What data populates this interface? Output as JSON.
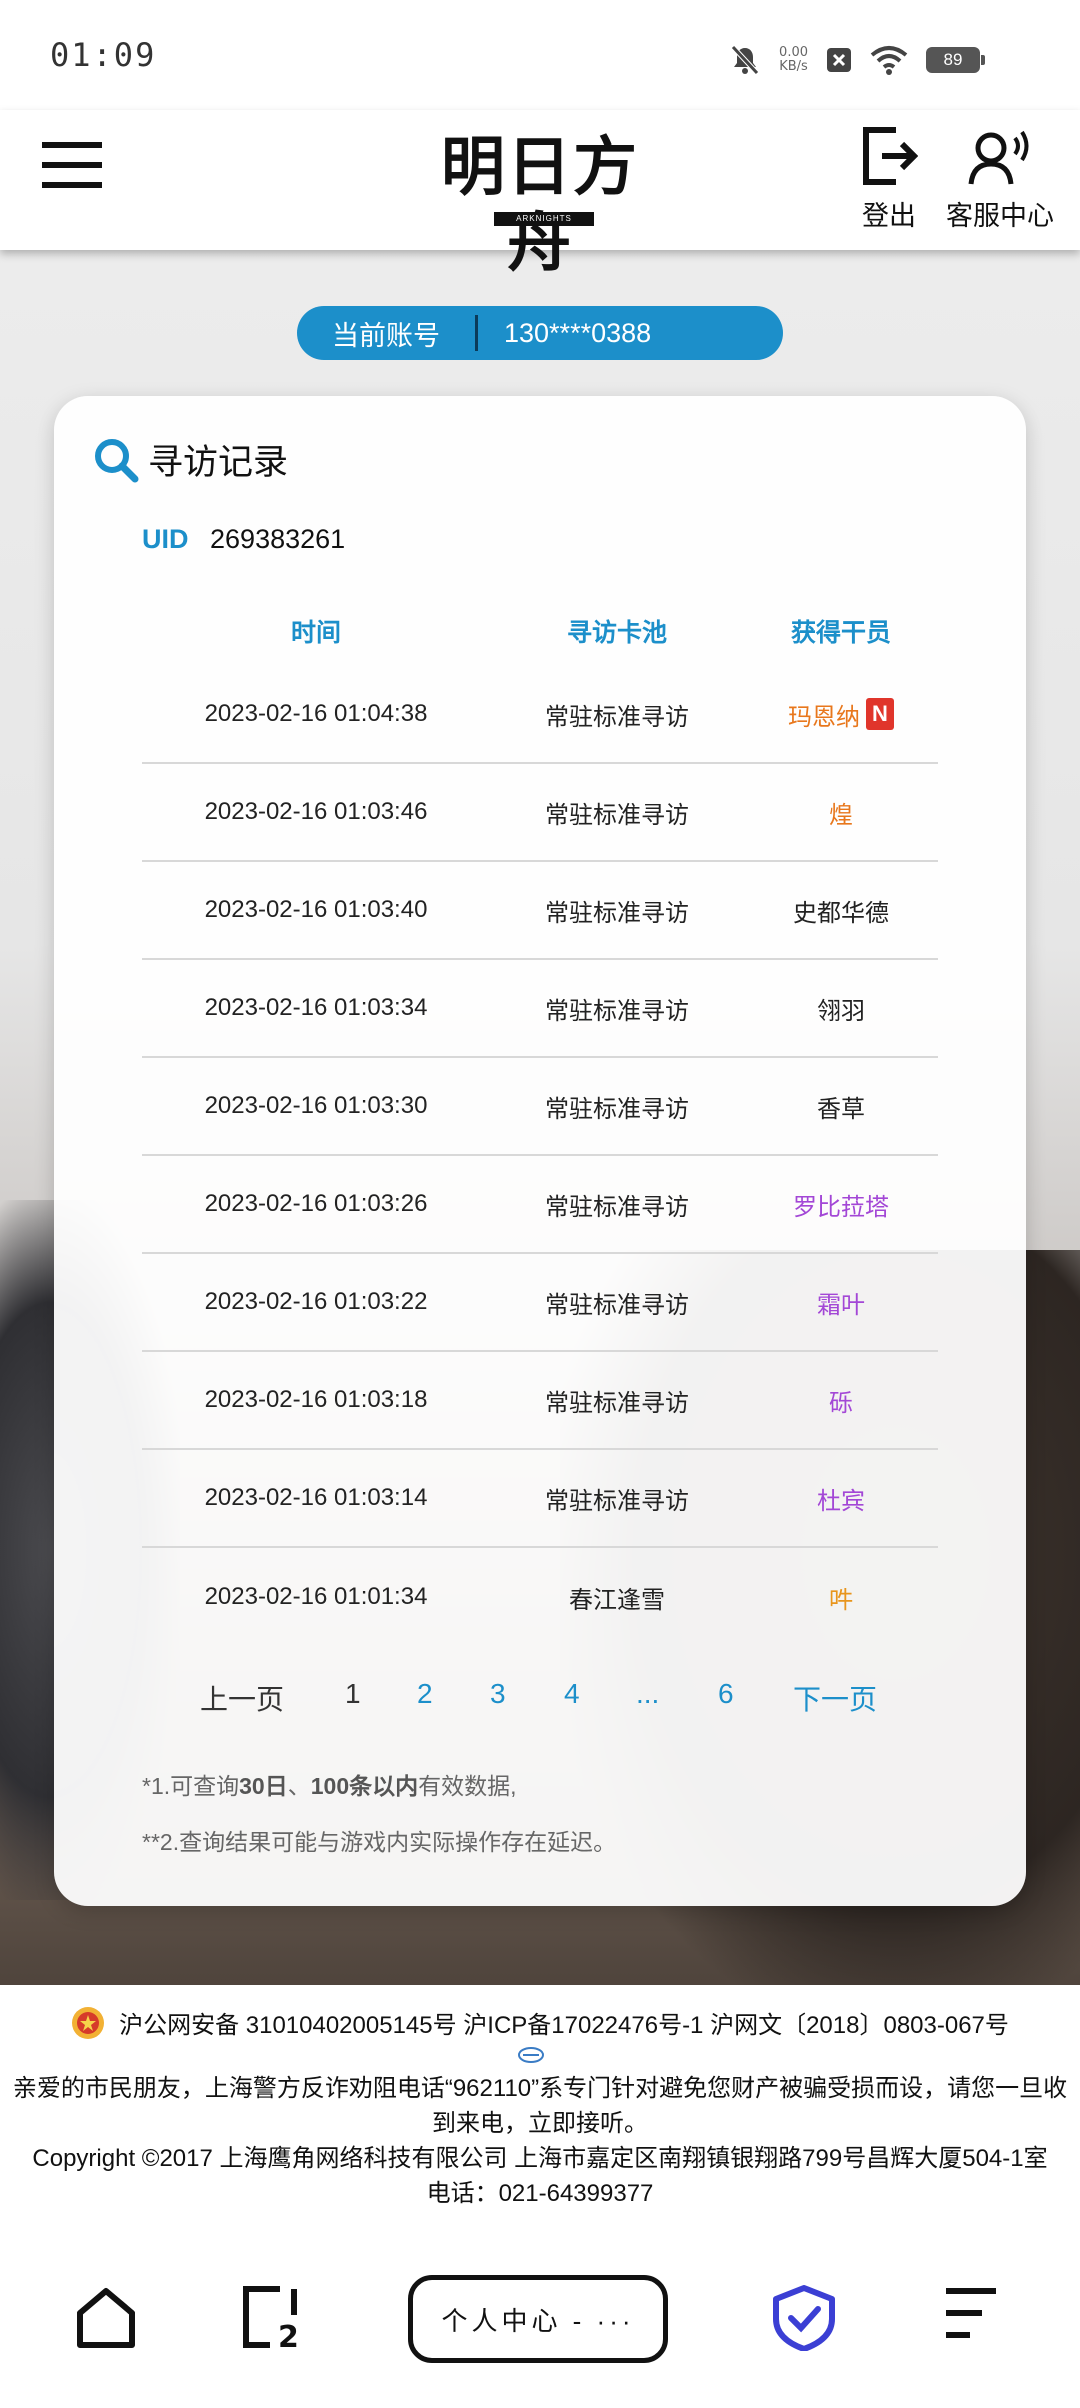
{
  "status_bar": {
    "time": "01:09",
    "speed_value": "0.00",
    "speed_unit": "KB/s",
    "battery": "89"
  },
  "header": {
    "logo_text": "明日方舟",
    "logo_sub": "ARKNIGHTS",
    "logout_label": "登出",
    "service_label": "客服中心"
  },
  "account": {
    "label": "当前账号",
    "value": "130****0388"
  },
  "record": {
    "title": "寻访记录",
    "uid_label": "UID",
    "uid_value": "269383261",
    "columns": [
      "时间",
      "寻访卡池",
      "获得干员"
    ],
    "rows": [
      {
        "time": "2023-02-16 01:04:38",
        "pool": "常驻标准寻访",
        "operator": "玛恩纳",
        "new": "N",
        "color": "#e8771c"
      },
      {
        "time": "2023-02-16 01:03:46",
        "pool": "常驻标准寻访",
        "operator": "煌",
        "new": "",
        "color": "#e8771c"
      },
      {
        "time": "2023-02-16 01:03:40",
        "pool": "常驻标准寻访",
        "operator": "史都华德",
        "new": "",
        "color": "#222222"
      },
      {
        "time": "2023-02-16 01:03:34",
        "pool": "常驻标准寻访",
        "operator": "翎羽",
        "new": "",
        "color": "#222222"
      },
      {
        "time": "2023-02-16 01:03:30",
        "pool": "常驻标准寻访",
        "operator": "香草",
        "new": "",
        "color": "#222222"
      },
      {
        "time": "2023-02-16 01:03:26",
        "pool": "常驻标准寻访",
        "operator": "罗比菈塔",
        "new": "",
        "color": "#a347d6"
      },
      {
        "time": "2023-02-16 01:03:22",
        "pool": "常驻标准寻访",
        "operator": "霜叶",
        "new": "",
        "color": "#a347d6"
      },
      {
        "time": "2023-02-16 01:03:18",
        "pool": "常驻标准寻访",
        "operator": "砾",
        "new": "",
        "color": "#a347d6"
      },
      {
        "time": "2023-02-16 01:03:14",
        "pool": "常驻标准寻访",
        "operator": "杜宾",
        "new": "",
        "color": "#a347d6"
      },
      {
        "time": "2023-02-16 01:01:34",
        "pool": "春江逢雪",
        "operator": "吽",
        "new": "",
        "color": "#e8951c"
      }
    ],
    "pager": {
      "prev": "上一页",
      "current": "1",
      "pages": [
        "2",
        "3",
        "4"
      ],
      "ellipsis": "...",
      "last": "6",
      "next": "下一页"
    },
    "notes": {
      "n1_pre": "*1.可查询",
      "n1_b1": "30日",
      "n1_sep": "、",
      "n1_b2": "100条以内",
      "n1_post": "有效数据,",
      "n2": "**2.查询结果可能与游戏内实际操作存在延迟。"
    }
  },
  "footer": {
    "line1": "沪公网安备 31010402005145号  沪ICP备17022476号-1  沪网文〔2018〕0803-067号",
    "notice": "亲爱的市民朋友，上海警方反诈劝阻电话“962110”系专门针对避免您财产被骗受损而设，请您一旦收到来电，立即接听。",
    "copyright": "Copyright ©2017 上海鹰角网络科技有限公司  上海市嘉定区南翔镇银翔路799号昌辉大厦504-1室",
    "phone": "电话：021-64399377"
  },
  "bottom_nav": {
    "center_label": "个人中心 - ···",
    "tabs_count": "2"
  },
  "colors": {
    "accent": "#1c8fca",
    "six_star": "#e8771c",
    "five_star": "#a347d6",
    "new_badge": "#e0352b"
  }
}
